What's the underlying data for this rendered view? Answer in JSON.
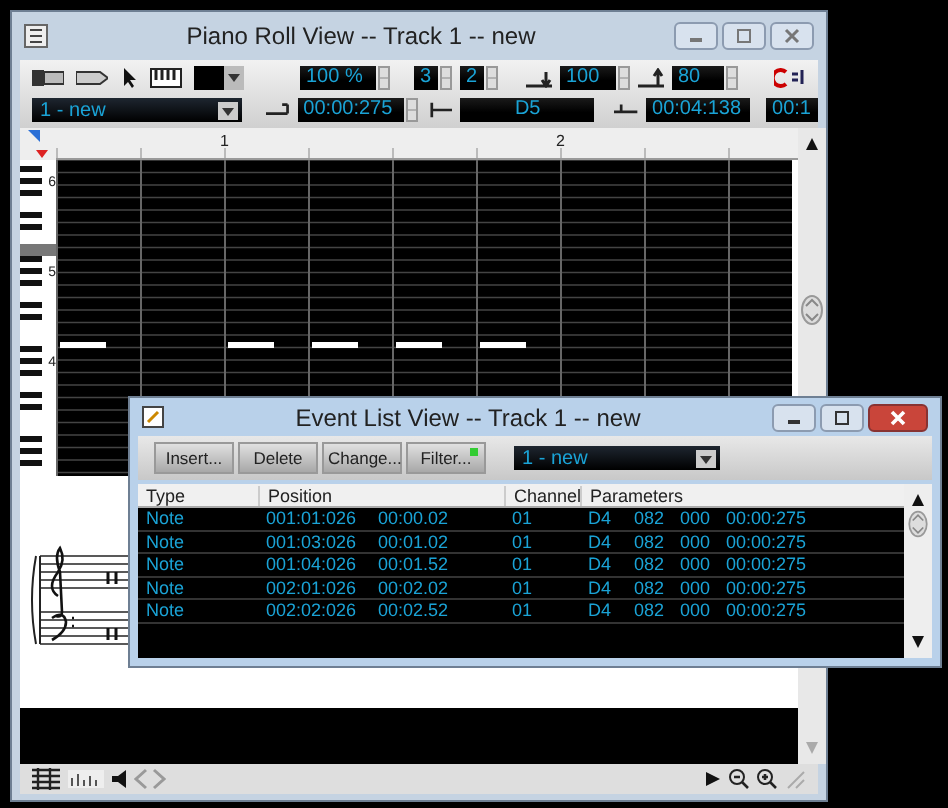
{
  "piano_roll": {
    "title": "Piano Roll View -- Track 1 -- new",
    "zoom": "100 %",
    "spin_a": "3",
    "spin_b": "2",
    "velocity_on": "100",
    "velocity_off": "80",
    "track": "1 - new",
    "duration": "00:00:275",
    "pitch": "D5",
    "time": "00:04:138",
    "time_cut": "00:1",
    "ruler": [
      "1",
      "2"
    ],
    "octaves": [
      "6",
      "5",
      "4"
    ]
  },
  "event_list": {
    "title": "Event List View -- Track 1 -- new",
    "buttons": [
      "Insert...",
      "Delete",
      "Change...",
      "Filter..."
    ],
    "track": "1 - new",
    "columns": [
      "Type",
      "Position",
      "Channel",
      "Parameters"
    ],
    "rows": [
      {
        "type": "Note",
        "position": "001:01:026",
        "time": "00:00.02",
        "channel": "01",
        "parameters": [
          "D4",
          "082",
          "000",
          "00:00:275"
        ]
      },
      {
        "type": "Note",
        "position": "001:03:026",
        "time": "00:01.02",
        "channel": "01",
        "parameters": [
          "D4",
          "082",
          "000",
          "00:00:275"
        ]
      },
      {
        "type": "Note",
        "position": "001:04:026",
        "time": "00:01.52",
        "channel": "01",
        "parameters": [
          "D4",
          "082",
          "000",
          "00:00:275"
        ]
      },
      {
        "type": "Note",
        "position": "002:01:026",
        "time": "00:02.02",
        "channel": "01",
        "parameters": [
          "D4",
          "082",
          "000",
          "00:00:275"
        ]
      },
      {
        "type": "Note",
        "position": "002:02:026",
        "time": "00:02.52",
        "channel": "01",
        "parameters": [
          "D4",
          "082",
          "000",
          "00:00:275"
        ]
      }
    ]
  }
}
